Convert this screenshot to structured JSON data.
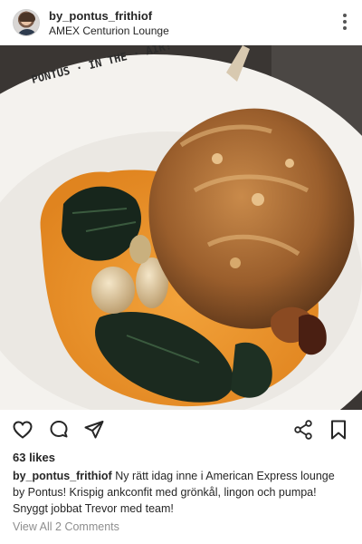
{
  "post": {
    "username": "by_pontus_frithiof",
    "location": "AMEX Centurion Lounge",
    "plate_text": "PONTUS · IN THE · AIR!",
    "likes": "63 likes",
    "caption_user": "by_pontus_frithiof",
    "caption_text": "Ny rätt idag inne i American Express lounge by Pontus! Krispig ankconfit med grönkål, lingon och pumpa! Snyggt jobbat Trevor med team!",
    "view_comments": "View All 2 Comments"
  },
  "icons": {
    "more": "more-vertical-icon",
    "like": "heart-icon",
    "comment": "comment-bubble-icon",
    "share": "paper-plane-icon",
    "share_alt": "share-nodes-icon",
    "save": "bookmark-icon"
  },
  "colors": {
    "text": "#262626",
    "muted": "#8e8e8e",
    "background": "#ffffff"
  }
}
